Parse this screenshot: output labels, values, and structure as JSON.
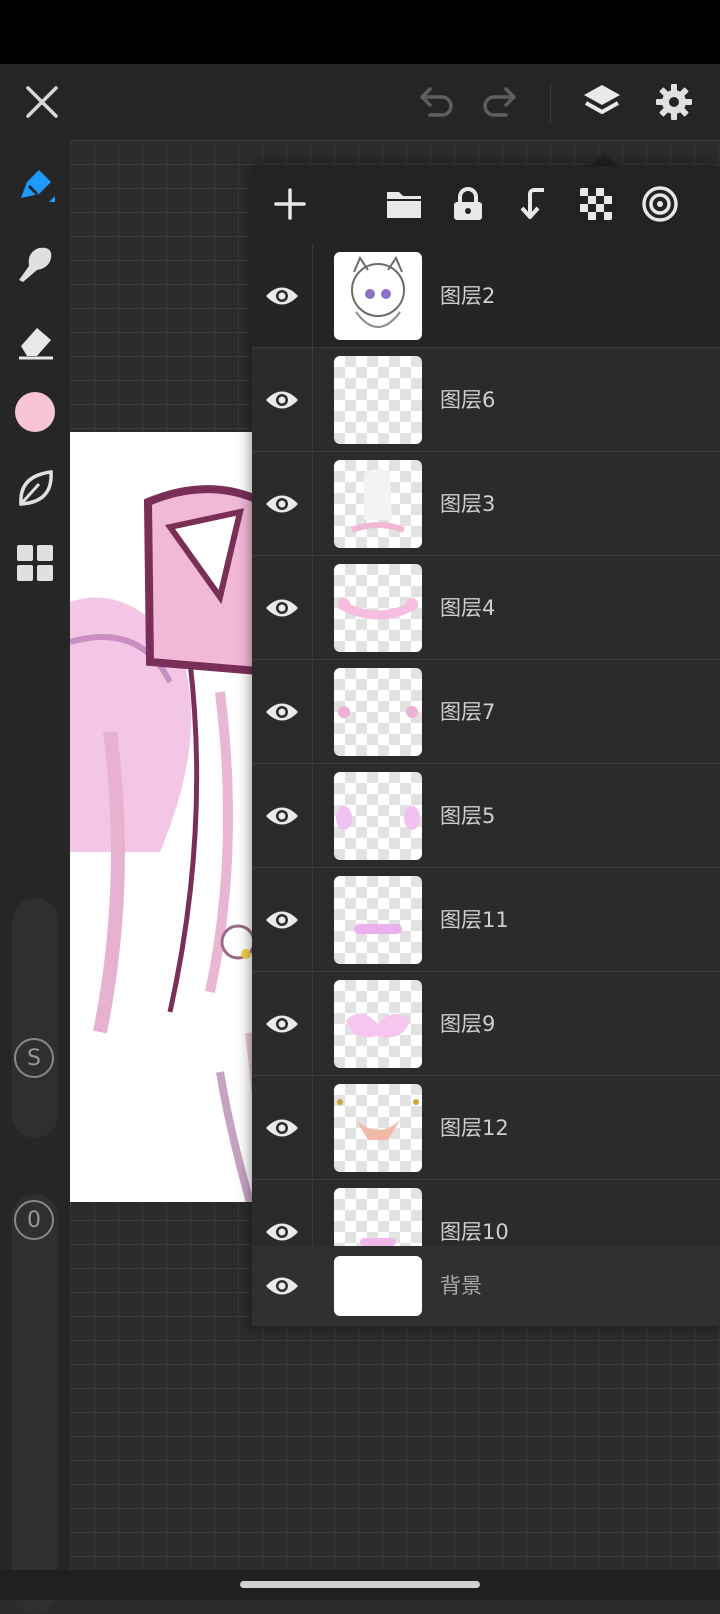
{
  "topbar": {
    "close_icon": "close-icon",
    "undo_icon": "undo-icon",
    "redo_icon": "redo-icon",
    "layers_icon": "layers-icon",
    "settings_icon": "gear-icon"
  },
  "tools": {
    "current_color": "#f7c4d8",
    "items": [
      "pen-tool-icon",
      "smudge-tool-icon",
      "eraser-tool-icon",
      "color-swatch",
      "leaf-brush-icon",
      "grid-menu-icon"
    ],
    "brush_size_badge": "S",
    "opacity_value": "0"
  },
  "layers_panel": {
    "toolbar_icons": [
      "add-layer-icon",
      "folder-icon",
      "lock-icon",
      "merge-down-icon",
      "transparency-icon",
      "clipping-icon"
    ],
    "layers": [
      {
        "name": "图层2",
        "visible": true
      },
      {
        "name": "图层6",
        "visible": true
      },
      {
        "name": "图层3",
        "visible": true
      },
      {
        "name": "图层4",
        "visible": true
      },
      {
        "name": "图层7",
        "visible": true
      },
      {
        "name": "图层5",
        "visible": true
      },
      {
        "name": "图层11",
        "visible": true
      },
      {
        "name": "图层9",
        "visible": true
      },
      {
        "name": "图层12",
        "visible": true
      },
      {
        "name": "图层10",
        "visible": true
      }
    ],
    "background": {
      "name": "背景",
      "visible": true
    }
  },
  "colors": {
    "accent": "#1e9bff",
    "pink": "#f7c4d8",
    "line": "#7a2f58"
  }
}
